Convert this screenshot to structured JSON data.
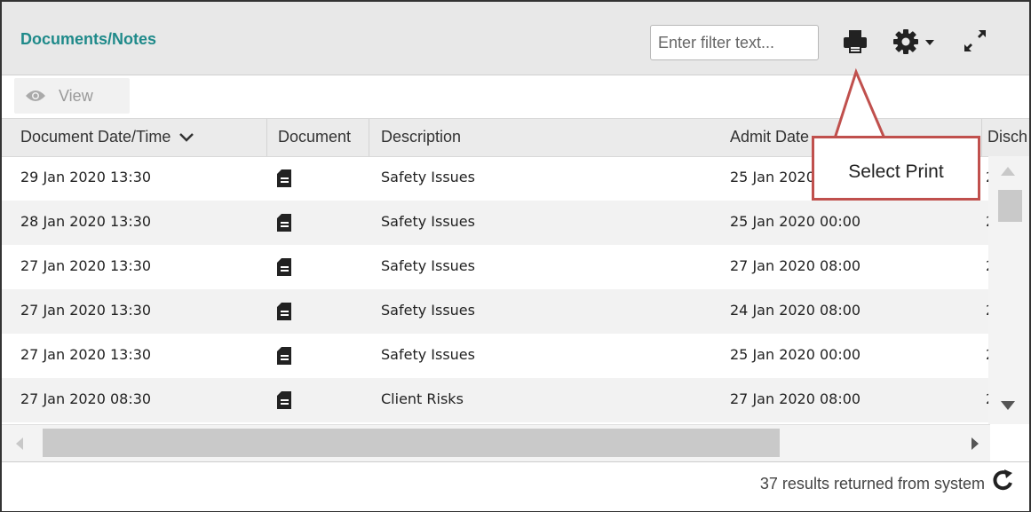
{
  "panel": {
    "title": "Documents/Notes"
  },
  "filter": {
    "placeholder": "Enter filter text..."
  },
  "toolbar": {
    "view_label": "View"
  },
  "columns": {
    "date": "Document Date/Time",
    "document": "Document",
    "description": "Description",
    "admit": "Admit Date",
    "discharge": "Disch"
  },
  "rows": [
    {
      "date": "29 Jan 2020 13:30",
      "description": "Safety Issues",
      "admit": "25 Jan 2020 00:00",
      "discharge": "2"
    },
    {
      "date": "28 Jan 2020 13:30",
      "description": "Safety Issues",
      "admit": "25 Jan 2020 00:00",
      "discharge": "2"
    },
    {
      "date": "27 Jan 2020 13:30",
      "description": "Safety Issues",
      "admit": "27 Jan 2020 08:00",
      "discharge": "2"
    },
    {
      "date": "27 Jan 2020 13:30",
      "description": "Safety Issues",
      "admit": "24 Jan 2020 08:00",
      "discharge": "2"
    },
    {
      "date": "27 Jan 2020 13:30",
      "description": "Safety Issues",
      "admit": "25 Jan 2020 00:00",
      "discharge": "2"
    },
    {
      "date": "27 Jan 2020 08:30",
      "description": "Client Risks",
      "admit": "27 Jan 2020 08:00",
      "discharge": "2"
    }
  ],
  "footer": {
    "status": "37 results returned from system"
  },
  "annotation": {
    "callout": "Select Print"
  },
  "icons": {
    "view": "eye-icon",
    "print": "printer-icon",
    "settings": "gear-icon",
    "settings_caret": "caret-down-icon",
    "expand": "expand-icon",
    "sort": "chevron-down-icon",
    "document": "document-icon",
    "refresh": "refresh-icon"
  },
  "colors": {
    "title": "#1f8a8a",
    "callout_border": "#c0504d"
  }
}
